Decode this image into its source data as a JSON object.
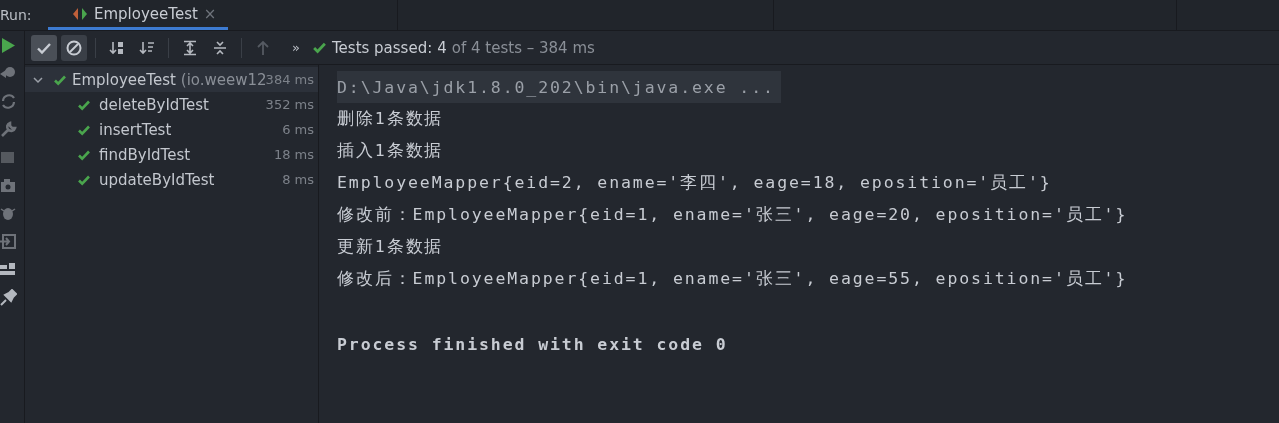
{
  "run_bar": {
    "label": "Run:",
    "tabs": [
      {
        "title": "EmployeeTest",
        "selected": true,
        "close": "×"
      }
    ]
  },
  "toolbar": {
    "buttons": [
      {
        "kind": "passed",
        "selected": true
      },
      {
        "kind": "ignored",
        "selected": true
      },
      {
        "kind": "sort-alpha",
        "selected": false
      },
      {
        "kind": "sort-duration",
        "selected": false
      },
      {
        "kind": "expand",
        "selected": false
      },
      {
        "kind": "collapse",
        "selected": false
      },
      {
        "kind": "up",
        "selected": false,
        "disabled": true
      }
    ],
    "more": "»",
    "status": {
      "label": "Tests passed:",
      "count": "4",
      "rest": "of 4 tests – 384 ms"
    }
  },
  "tree": {
    "root": {
      "name": "EmployeeTest",
      "package": "(io.weew12",
      "time": "384 ms",
      "expanded": true,
      "selected": true,
      "children": [
        {
          "name": "deleteByIdTest",
          "time": "352 ms",
          "selected": false
        },
        {
          "name": "insertTest",
          "time": "6 ms",
          "selected": false
        },
        {
          "name": "findByIdTest",
          "time": "18 ms",
          "selected": false
        },
        {
          "name": "updateByIdTest",
          "time": "8 ms",
          "selected": false
        }
      ]
    }
  },
  "console": [
    {
      "kind": "command",
      "text": "D:\\Java\\jdk1.8.0_202\\bin\\java.exe ..."
    },
    {
      "kind": "output",
      "text": "删除1条数据"
    },
    {
      "kind": "output",
      "text": "插入1条数据"
    },
    {
      "kind": "output",
      "text": "EmployeeMapper{eid=2, ename='李四', eage=18, eposition='员工'}"
    },
    {
      "kind": "output",
      "text": "修改前：EmployeeMapper{eid=1, ename='张三', eage=20, eposition='员工'}"
    },
    {
      "kind": "output",
      "text": "更新1条数据"
    },
    {
      "kind": "output",
      "text": "修改后：EmployeeMapper{eid=1, ename='张三', eage=55, eposition='员工'}"
    },
    {
      "kind": "exit",
      "text": "Process finished with exit code 0"
    }
  ]
}
